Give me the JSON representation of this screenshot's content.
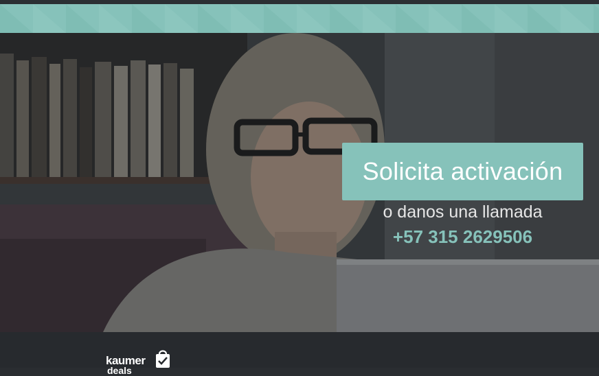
{
  "hero": {
    "cta_label": "Solicita activación",
    "call_text": "o danos una llamada",
    "phone": "+57 315 2629506"
  },
  "footer": {
    "logo_text": "kaumer",
    "logo_subtext": "deals"
  },
  "colors": {
    "accent": "#86c2ba",
    "footer": "#272a2e"
  },
  "icons": [
    "shopping-bag-icon"
  ]
}
